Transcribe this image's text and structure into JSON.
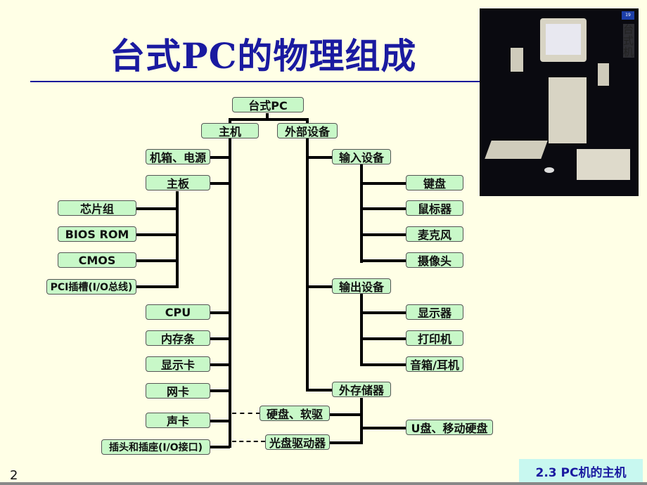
{
  "slide": {
    "title": "台式PC的物理组成",
    "page_number": "2",
    "footer": "2.3  PC机的主机"
  },
  "photo": {
    "badge": "19",
    "vertical_label": "台式机",
    "description": "desktop computer system photo"
  },
  "diagram": {
    "root": "台式PC",
    "host": "主机",
    "peripherals": "外部设备",
    "host_items": {
      "case_power": "机箱、电源",
      "motherboard": "主板",
      "cpu": "CPU",
      "memory": "内存条",
      "video_card": "显示卡",
      "network_card": "网卡",
      "sound_card": "声卡",
      "io_ports": "插头和插座(I/O接口)"
    },
    "motherboard_items": {
      "chipset": "芯片组",
      "bios": "BIOS ROM",
      "cmos": "CMOS",
      "pci": "PCI插槽(I/O总线)"
    },
    "input": {
      "label": "输入设备",
      "items": [
        "键盘",
        "鼠标器",
        "麦克风",
        "摄像头"
      ]
    },
    "output": {
      "label": "输出设备",
      "items": [
        "显示器",
        "打印机",
        "音箱/耳机"
      ]
    },
    "storage": {
      "label": "外存储器",
      "items": [
        "硬盘、软驱",
        "光盘驱动器",
        "U盘、移动硬盘"
      ]
    }
  }
}
